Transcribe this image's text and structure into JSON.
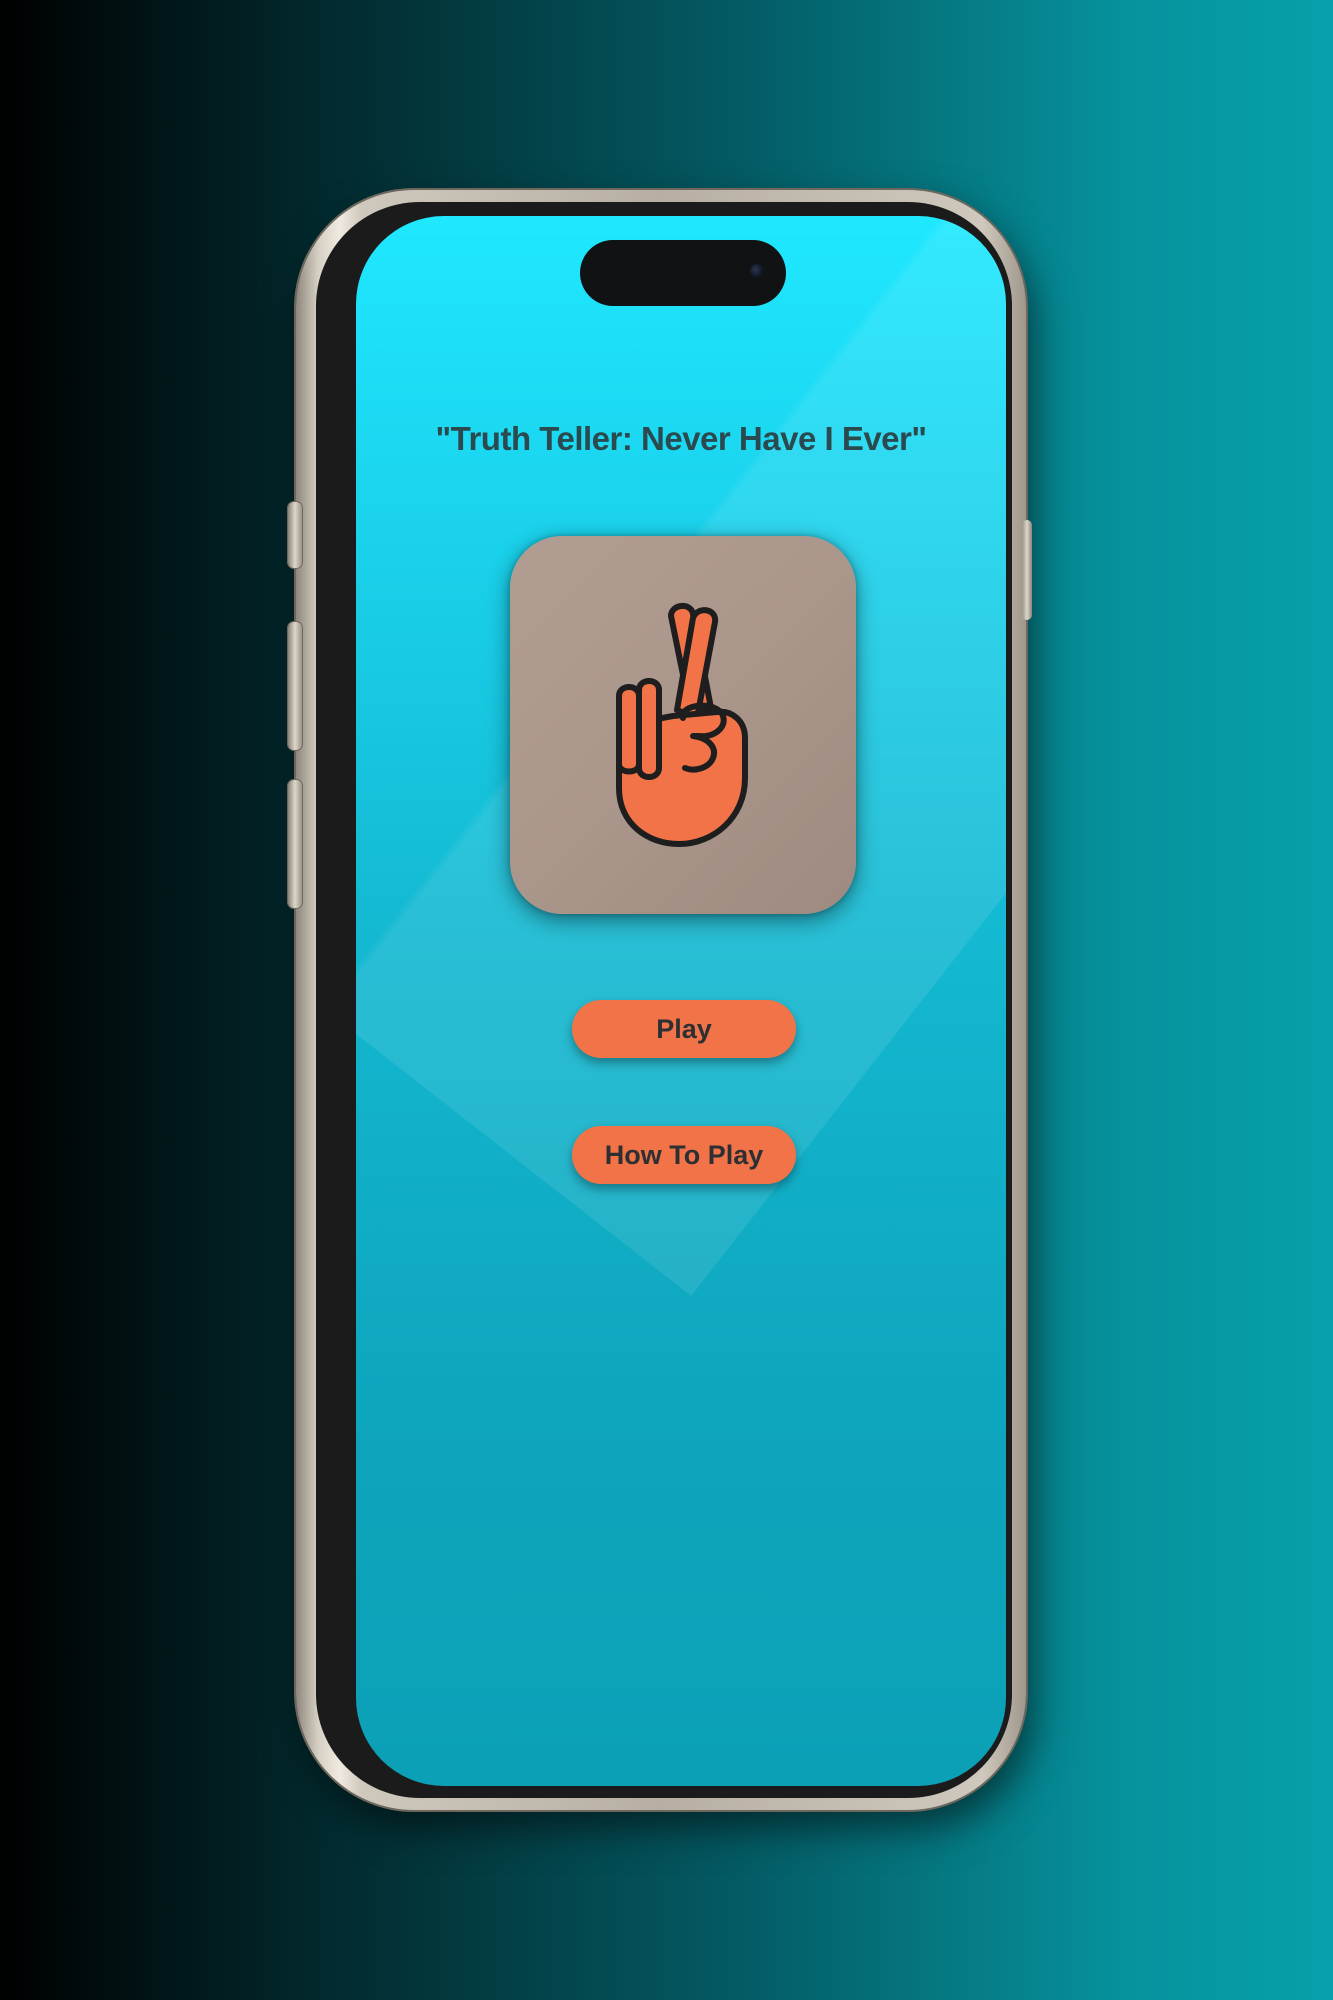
{
  "app": {
    "title": "\"Truth Teller: Never Have I Ever\"",
    "logo_icon": "crossed-fingers-icon"
  },
  "buttons": {
    "play_label": "Play",
    "how_to_play_label": "How To Play"
  },
  "colors": {
    "screen_top": "#1fe8ff",
    "screen_bottom": "#0ba0b6",
    "button_fill": "#f27348",
    "logo_tile": "#ab968b",
    "icon_fill": "#f27348",
    "title_text": "#2b4a50"
  }
}
